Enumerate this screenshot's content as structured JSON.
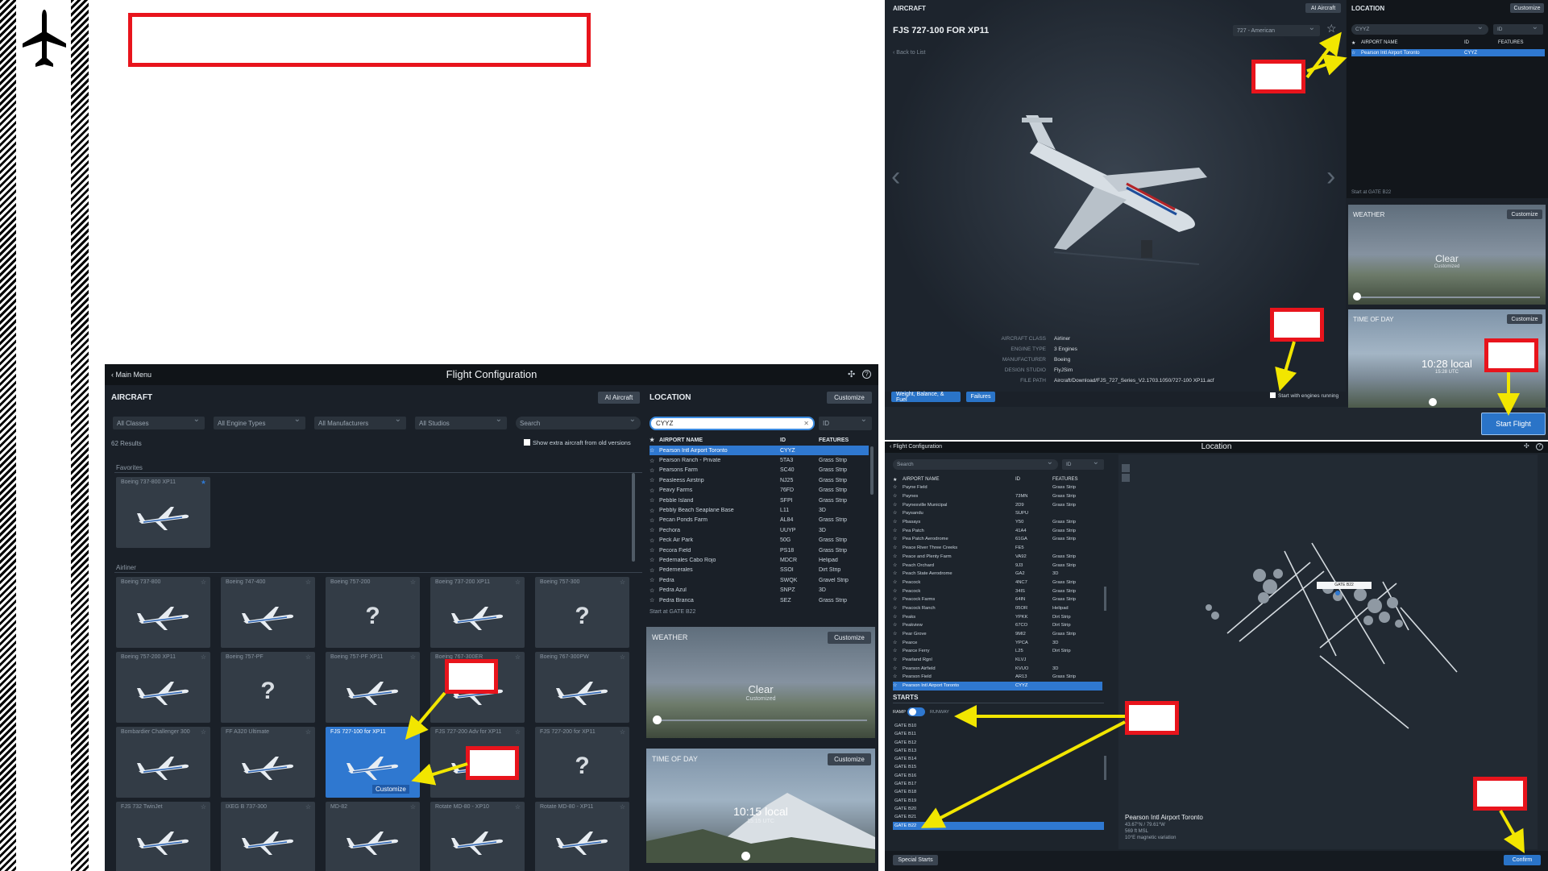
{
  "top_placeholder": "",
  "panel_a": {
    "back": "Main Menu",
    "title": "Flight Configuration",
    "aircraft_heading": "AIRCRAFT",
    "ai_aircraft": "AI Aircraft",
    "filters": [
      "All Classes",
      "All Engine Types",
      "All Manufacturers",
      "All Studios"
    ],
    "search_placeholder": "Search",
    "results": "62 Results",
    "show_extra": "Show extra aircraft from old versions",
    "favorites": "Favorites",
    "airliner": "Airliner",
    "fav_tile": "Boeing 737-800 XP11",
    "tiles": [
      {
        "name": "Boeing 737-800",
        "kind": "plane"
      },
      {
        "name": "Boeing 747-400",
        "kind": "plane"
      },
      {
        "name": "Boeing 757-200",
        "kind": "q"
      },
      {
        "name": "Boeing 737-200 XP11",
        "kind": "plane"
      },
      {
        "name": "Boeing 757-300",
        "kind": "q"
      },
      {
        "name": "Boeing 757-200 XP11",
        "kind": "plane"
      },
      {
        "name": "Boeing 757-PF",
        "kind": "q"
      },
      {
        "name": "Boeing 757-PF XP11",
        "kind": "plane"
      },
      {
        "name": "Boeing 767-300ER",
        "kind": "plane"
      },
      {
        "name": "Boeing 767-300PW",
        "kind": "plane"
      },
      {
        "name": "Bombardier Challenger 300",
        "kind": "plane"
      },
      {
        "name": "FF A320 Ultimate",
        "kind": "plane"
      },
      {
        "name": "FJS 727-100 for XP11",
        "kind": "plane",
        "selected": true
      },
      {
        "name": "FJS 727-200 Adv for XP11",
        "kind": "plane"
      },
      {
        "name": "FJS 727-200 for XP11",
        "kind": "q"
      },
      {
        "name": "FJS 732 TwinJet",
        "kind": "plane"
      },
      {
        "name": "IXEG B 737-300",
        "kind": "plane"
      },
      {
        "name": "MD-82",
        "kind": "plane"
      },
      {
        "name": "Rotate MD-80 - XP10",
        "kind": "plane"
      },
      {
        "name": "Rotate MD-80 - XP11",
        "kind": "plane"
      }
    ],
    "customize_tile": "Customize",
    "location_heading": "LOCATION",
    "customize": "Customize",
    "location_search": "CYYZ",
    "id_drop": "ID",
    "cols": [
      "AIRPORT NAME",
      "ID",
      "FEATURES"
    ],
    "airports": [
      [
        "Pearson Intl Airport Toronto",
        "CYYZ",
        ""
      ],
      [
        "Pearson Ranch - Private",
        "5TA3",
        "Grass Strip"
      ],
      [
        "Pearsons Farm",
        "SC40",
        "Grass Strip"
      ],
      [
        "Peasleess Airstrip",
        "NJ25",
        "Grass Strip"
      ],
      [
        "Peavy Farms",
        "76FD",
        "Grass Strip"
      ],
      [
        "Pebble Island",
        "SFPI",
        "Grass Strip"
      ],
      [
        "Pebbly Beach Seaplane Base",
        "L11",
        "3D"
      ],
      [
        "Pecan Ponds Farm",
        "AL84",
        "Grass Strip"
      ],
      [
        "Pechora",
        "UUYP",
        "3D"
      ],
      [
        "Peck Air Park",
        "50G",
        "Grass Strip"
      ],
      [
        "Pecora Field",
        "PS18",
        "Grass Strip"
      ],
      [
        "Pedernales Cabo Rojo",
        "MDCR",
        "Helipad"
      ],
      [
        "Pedernerales",
        "SSOI",
        "Dirt Strip"
      ],
      [
        "Pedra",
        "SWQK",
        "Gravel Strip"
      ],
      [
        "Pedra Azul",
        "SNPZ",
        "3D"
      ],
      [
        "Pedra Branca",
        "SEZ",
        "Grass Strip"
      ]
    ],
    "start_at": "Start at GATE B22",
    "weather_heading": "WEATHER",
    "weather_text": "Clear",
    "weather_sub": "Customized",
    "time_heading": "TIME OF DAY",
    "time_text": "10:15 local",
    "time_sub": "15:15 UTC"
  },
  "panel_b": {
    "aircraft_heading": "AIRCRAFT",
    "ai_aircraft": "AI Aircraft",
    "title": "FJS 727-100 FOR XP11",
    "livery": "727 - American",
    "back": "Back to List",
    "props": [
      [
        "AIRCRAFT CLASS",
        "Airliner"
      ],
      [
        "ENGINE TYPE",
        "3 Engines"
      ],
      [
        "MANUFACTURER",
        "Boeing"
      ],
      [
        "DESIGN STUDIO",
        "FlyJSim"
      ],
      [
        "FILE PATH",
        "Aircraft/Download/FJS_727_Series_V2.1703.1050/727-100 XP11.acf"
      ]
    ],
    "wbf": "Weight, Balance, & Fuel",
    "failures": "Failures",
    "engines_running": "Start with engines running",
    "location_heading": "LOCATION",
    "customize": "Customize",
    "search": "CYYZ",
    "id": "ID",
    "cols": [
      "AIRPORT NAME",
      "ID",
      "FEATURES"
    ],
    "airport": [
      "Pearson Intl Airport Toronto",
      "CYYZ"
    ],
    "start_at": "Start at GATE B22",
    "weather_heading": "WEATHER",
    "weather_text": "Clear",
    "weather_sub": "Customized",
    "time_heading": "TIME OF DAY",
    "time_text": "10:28 local",
    "time_sub": "15:28 UTC",
    "start_flight": "Start Flight"
  },
  "panel_c": {
    "back": "Flight Configuration",
    "title": "Location",
    "search": "Search",
    "id": "ID",
    "cols": [
      "AIRPORT NAME",
      "ID",
      "FEATURES"
    ],
    "airports": [
      [
        "Payne Field",
        "",
        "Grass Strip"
      ],
      [
        "Paynes",
        "73MN",
        "Grass Strip"
      ],
      [
        "Paynesville Municipal",
        "2D9",
        "Grass Strip"
      ],
      [
        "Paysandu",
        "SUPU",
        ""
      ],
      [
        "Pbasays",
        "Y50",
        "Grass Strip"
      ],
      [
        "Pea Patch",
        "41A4",
        "Grass Strip"
      ],
      [
        "Pea Patch Aerodrome",
        "61GA",
        "Grass Strip"
      ],
      [
        "Peace River Three Creeks",
        "FE5",
        ""
      ],
      [
        "Peace and Plenty Farm",
        "VA92",
        "Grass Strip"
      ],
      [
        "Peach Orchard",
        "9J3",
        "Grass Strip"
      ],
      [
        "Peach State Aerodrome",
        "GA2",
        "3D"
      ],
      [
        "Peacock",
        "4NC7",
        "Grass Strip"
      ],
      [
        "Peacock",
        "34IS",
        "Grass Strip"
      ],
      [
        "Peacock Farms",
        "64IN",
        "Grass Strip"
      ],
      [
        "Peacock Ranch",
        "05OR",
        "Helipad"
      ],
      [
        "Peaks",
        "YPKK",
        "Dirt Strip"
      ],
      [
        "Peakview",
        "67CO",
        "Dirt Strip"
      ],
      [
        "Pear Grove",
        "9MI2",
        "Grass Strip"
      ],
      [
        "Pearce",
        "YPCA",
        "3D"
      ],
      [
        "Pearce Ferry",
        "L25",
        "Dirt Strip"
      ],
      [
        "Pearland Rgnl",
        "KLVJ",
        ""
      ],
      [
        "Pearson Airfield",
        "KVUO",
        "3D"
      ],
      [
        "Pearson Field",
        "AR13",
        "Grass Strip"
      ],
      [
        "Pearson Intl Airport Toronto",
        "CYYZ",
        ""
      ]
    ],
    "starts_heading": "STARTS",
    "ramp": "RAMP",
    "runway": "RUNWAY",
    "gates": [
      "GATE B10",
      "GATE B11",
      "GATE B12",
      "GATE B13",
      "GATE B14",
      "GATE B15",
      "GATE B16",
      "GATE B17",
      "GATE B18",
      "GATE B19",
      "GATE B20",
      "GATE B21",
      "GATE B22"
    ],
    "gate_label": "GATE B22",
    "airport_name": "Pearson Intl Airport Toronto",
    "coords": "43.67°N / 79.61°W",
    "elev": "569 ft MSL",
    "magvar": "10°E magnetic variation",
    "special_starts": "Special Starts",
    "confirm": "Confirm"
  },
  "colors": {
    "accent": "#2f78d0",
    "annotation_red": "#e8141c",
    "annotation_yellow": "#f2e600",
    "panel": "#1a2028"
  }
}
